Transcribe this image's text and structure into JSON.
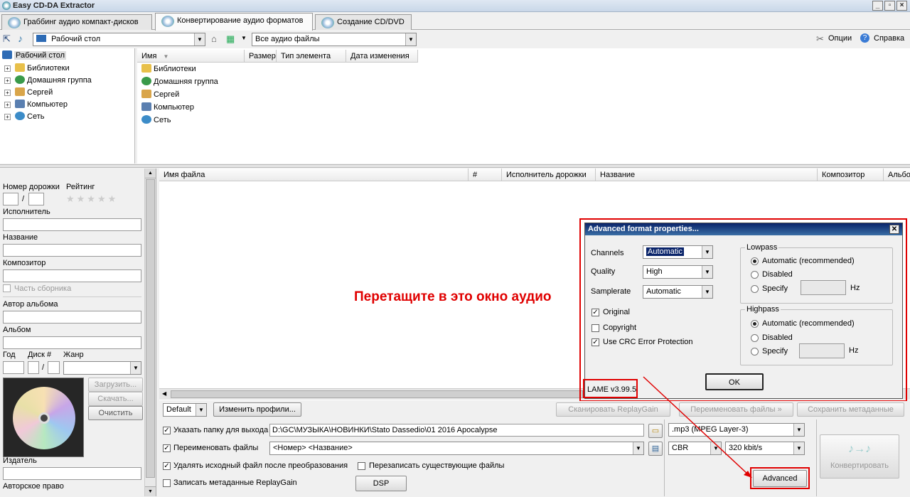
{
  "app": {
    "title": "Easy CD-DA Extractor"
  },
  "tabs": [
    {
      "label": "Граббинг аудио компакт-дисков"
    },
    {
      "label": "Конвертирование аудио форматов"
    },
    {
      "label": "Создание CD/DVD"
    }
  ],
  "toolbar": {
    "location": "Рабочий стол",
    "filter": "Все аудио файлы",
    "options": "Опции",
    "help": "Справка"
  },
  "tree": {
    "root": "Рабочий стол",
    "items": [
      "Библиотеки",
      "Домашняя группа",
      "Сергей",
      "Компьютер",
      "Сеть"
    ]
  },
  "filelist": {
    "columns": [
      "Имя",
      "Размер",
      "Тип элемента",
      "Дата изменения"
    ],
    "items": [
      "Библиотеки",
      "Домашняя группа",
      "Сергей",
      "Компьютер",
      "Сеть"
    ]
  },
  "tags": {
    "track_no": "Номер дорожки",
    "rating": "Рейтинг",
    "slash": "/",
    "artist": "Исполнитель",
    "title": "Название",
    "composer": "Композитор",
    "compilation": "Часть сборника",
    "album_artist": "Автор альбома",
    "album": "Альбом",
    "year": "Год",
    "disc": "Диск #",
    "genre": "Жанр",
    "load": "Загрузить...",
    "download": "Скачать...",
    "clear": "Очистить",
    "publisher": "Издатель",
    "copyright": "Авторское право"
  },
  "main": {
    "columns": [
      "Имя файла",
      "#",
      "Исполнитель дорожки",
      "Название",
      "Композитор",
      "Альбо"
    ],
    "drop_hint": "Перетащите в это окно аудио"
  },
  "dialog": {
    "title": "Advanced format properties...",
    "channels_label": "Channels",
    "channels_value": "Automatic",
    "quality_label": "Quality",
    "quality_value": "High",
    "samplerate_label": "Samplerate",
    "samplerate_value": "Automatic",
    "original": "Original",
    "copyright": "Copyright",
    "crc": "Use CRC Error Protection",
    "lowpass": "Lowpass",
    "highpass": "Highpass",
    "auto_rec": "Automatic (recommended)",
    "disabled": "Disabled",
    "specify": "Specify",
    "hz": "Hz",
    "ok": "OK",
    "version": "LAME v3.99.5"
  },
  "bottom": {
    "profile": "Default",
    "change_profiles": "Изменить профили...",
    "scan_replaygain": "Сканировать ReplayGain",
    "rename_files_btn": "Переименовать файлы »",
    "save_metadata": "Сохранить метаданные",
    "output_folder_label": "Указать папку для выхода",
    "output_folder": "D:\\GC\\МУЗЫКА\\НОВИНКИ\\Stato Dassedio\\01 2016 Apocalypse",
    "rename_label": "Переименовать файлы",
    "rename_pattern": "<Номер> <Название>",
    "delete_source": "Удалять исходный файл после преобразования",
    "overwrite": "Перезаписать существующие файлы",
    "write_replaygain": "Записать метаданные ReplayGain",
    "dsp": "DSP",
    "format": ".mp3 (MPEG Layer-3)",
    "mode": "CBR",
    "bitrate": "320 kbit/s",
    "advanced": "Advanced",
    "convert": "Конвертировать"
  },
  "colors": {
    "accent_red": "#e00000",
    "dialog_title": "#0a246a"
  }
}
